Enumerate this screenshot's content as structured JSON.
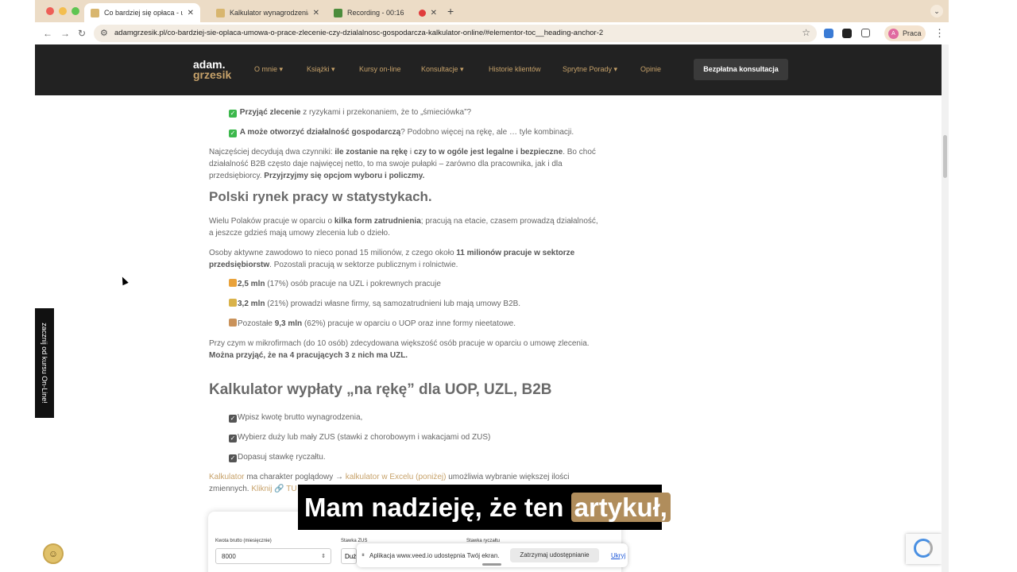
{
  "browser": {
    "tabs": [
      {
        "title": "Co bardziej się opłaca - umow",
        "active": true,
        "favicon_color": "#d8b66f"
      },
      {
        "title": "Kalkulator wynagrodzenia UO",
        "active": false,
        "favicon_color": "#d8b66f"
      },
      {
        "title": "Recording - 00:16",
        "active": false,
        "favicon_color": "#4c8c3c"
      }
    ],
    "recording_dot_color": "#e03c3c",
    "new_tab_glyph": "+",
    "tab_close_glyph": "✕",
    "url": "adamgrzesik.pl/co-bardziej-sie-oplaca-umowa-o-prace-zlecenie-czy-dzialalnosc-gospodarcza-kalkulator-online/#elementor-toc__heading-anchor-2",
    "profile_label": "Praca",
    "profile_initial": "A"
  },
  "site": {
    "logo_line1": "adam.",
    "logo_line2": "grzesik",
    "nav": [
      {
        "label": "O mnie ▾"
      },
      {
        "label": "Książki ▾"
      },
      {
        "label": "Kursy on-line"
      },
      {
        "label": "Konsultacje ▾"
      },
      {
        "label": "Historie klientów"
      },
      {
        "label": "Sprytne Porady ▾"
      },
      {
        "label": "Opinie"
      }
    ],
    "cta": "Bezpłatna konsultacja",
    "side_tab": "zacznij od kursu On-Line!"
  },
  "article": {
    "li_top_strong": "Przyjąć zlecenie",
    "li_top_rest": " z ryzykami i przekonaniem, że to „śmieciówka”?",
    "li_b2b_strong": "A może otworzyć działalność gospodarczą",
    "li_b2b_rest": "? Podobno więcej na rękę, ale … tyle kombinacji.",
    "p1_a": "Najczęściej decydują dwa czynniki: ",
    "p1_b": "ile zostanie na rękę",
    "p1_c": " i ",
    "p1_d": "czy to w ogóle jest legalne i bezpieczne",
    "p1_e": ". Bo choć działalność B2B często daje najwięcej netto, to ma swoje pułapki – zarówno dla pracownika, jak i dla przedsiębiorcy. ",
    "p1_f": "Przyjrzyjmy się opcjom wyboru i policzmy.",
    "h2_1": "Polski rynek pracy w statystykach.",
    "p2_a": "Wielu Polaków pracuje w oparciu o ",
    "p2_b": "kilka form zatrudnienia",
    "p2_c": "; pracują na etacie, czasem prowadzą działalność, a jeszcze gdzieś mają umowy zlecenia lub o dzieło.",
    "p3_a": "Osoby aktywne zawodowo to nieco ponad 15 milionów, z czego około ",
    "p3_b": "11 milionów pracuje w sektorze przedsiębiorstw",
    "p3_c": ". Pozostali pracują w sektorze publicznym i rolnictwie.",
    "s1_b": "2,5 mln",
    "s1_r": " (17%) osób pracuje na UZL i pokrewnych pracuje",
    "s2_b": "3,2 mln",
    "s2_r": " (21%) prowadzi własne firmy, są samozatrudnieni lub mają umowy B2B.",
    "s3_a": "Pozostałe ",
    "s3_b": "9,3 mln",
    "s3_r": " (62%) pracuje w oparciu o UOP oraz inne formy nieetatowe.",
    "p4_a": "Przy czym w mikrofirmach (do 10 osób) zdecydowana większość osób pracuje w oparciu o umowę zlecenia. ",
    "p4_b": "Można przyjąć, że na 4 pracujących 3 z nich ma UZL.",
    "h2_2": "Kalkulator wypłaty „na rękę” dla UOP, UZL, B2B",
    "c1": "Wpisz kwotę brutto wynagrodzenia,",
    "c2": "Wybierz duży lub mały ZUS (stawki z chorobowym i wakacjami od ZUS)",
    "c3": "Dopasuj stawkę ryczałtu.",
    "p5_link1": "Kalkulator",
    "p5_mid": " ma charakter poglądowy → ",
    "p5_link2": "kalkulator w Excelu (poniżej)",
    "p5_rest": " umożliwia wybranie większej ilości zmiennych. ",
    "p5_link3": "Kliknij 🔗 TU"
  },
  "calculator": {
    "label_gross": "Kwota brutto (miesięcznie)",
    "gross_value": "8000",
    "label_zus": "Stawka ZUS",
    "zus_value": "Duż",
    "label_ryczalt": "Stawka ryczałtu"
  },
  "share_bar": {
    "text": "Aplikacja www.veed.io udostępnia Twój ekran.",
    "stop": "Zatrzymaj udostępnianie",
    "hide": "Ukryj"
  },
  "subtitle": {
    "text": "Mam nadzieję, że ten ",
    "highlight": "artykuł,"
  },
  "colors": {
    "accent_gold": "#c7a26a",
    "nav_bg": "#222222",
    "tab_strip": "#ecdcc6"
  }
}
